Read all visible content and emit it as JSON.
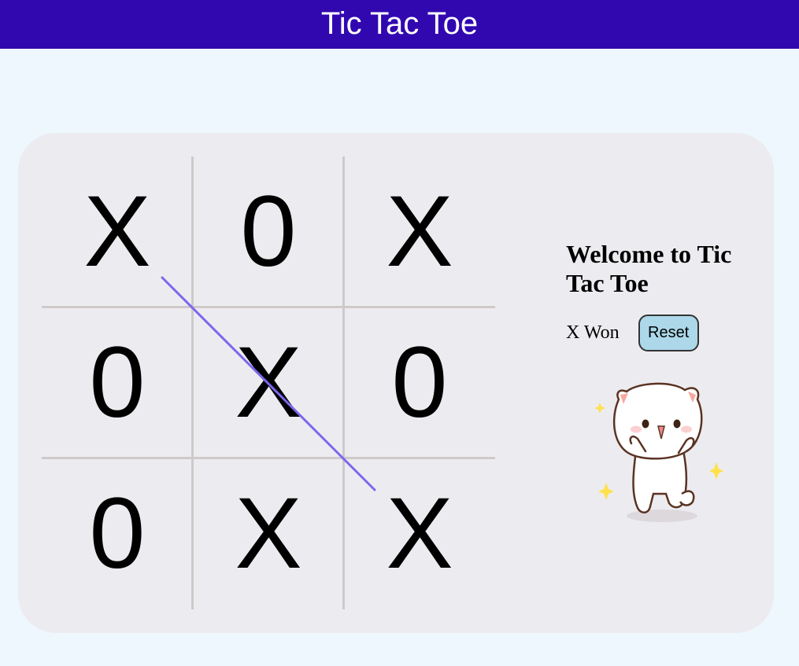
{
  "header": {
    "title": "Tic Tac Toe"
  },
  "board": {
    "cells": [
      "X",
      "0",
      "X",
      "0",
      "X",
      "0",
      "0",
      "X",
      "X"
    ],
    "winning_line_color": "#7b68ee"
  },
  "panel": {
    "welcome": "Welcome to Tic Tac Toe",
    "status": "X Won",
    "reset_label": "Reset"
  },
  "colors": {
    "header_bg": "#3108b0",
    "page_bg": "#eff7fe",
    "card_bg": "#ececf0",
    "grid_line": "#cfc9c9",
    "reset_bg": "#acd8e9"
  }
}
